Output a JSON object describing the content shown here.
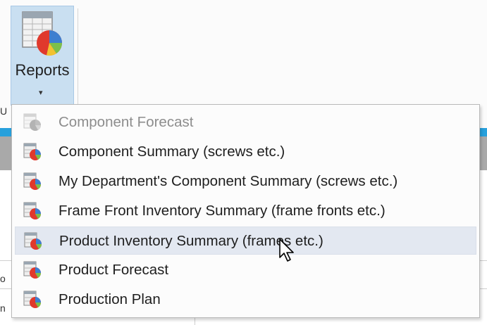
{
  "ribbon": {
    "reports_button": {
      "label": "Reports",
      "icon": "report-chart-icon",
      "dropdown_icon": "dropdown-arrow-icon",
      "arrow_glyph": "▾",
      "state": "pressed"
    }
  },
  "menu": {
    "items": [
      {
        "label": "Component Forecast",
        "icon": "report-icon",
        "enabled": false
      },
      {
        "label": "Component Summary (screws etc.)",
        "icon": "report-icon",
        "enabled": true
      },
      {
        "label": "My Department's Component Summary (screws etc.)",
        "icon": "report-icon",
        "enabled": true
      },
      {
        "label": "Frame Front Inventory Summary (frame fronts etc.)",
        "icon": "report-icon",
        "enabled": true
      },
      {
        "label": "Product Inventory Summary (frames etc.)",
        "icon": "report-icon",
        "enabled": true,
        "hovered": true
      },
      {
        "label": "Product Forecast",
        "icon": "report-icon",
        "enabled": true
      },
      {
        "label": "Production Plan",
        "icon": "report-icon",
        "enabled": true
      }
    ]
  },
  "background_fragments": {
    "left_edge_top": "U",
    "left_edge_mid": "o",
    "left_edge_low": "n"
  },
  "colors": {
    "accent_blue": "#27a0dc",
    "pressed_button": "#c9dff1",
    "hover_row": "#e3e8f1"
  }
}
